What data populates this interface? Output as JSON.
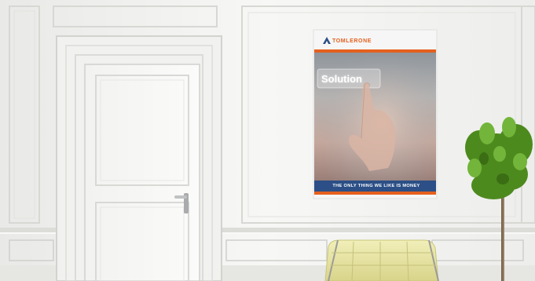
{
  "poster": {
    "brand": "TOMLERONE",
    "headline": "Solution",
    "tagline": "THE ONLY THING WE LIKE IS MONEY"
  },
  "colors": {
    "wall": "#f4f4f2",
    "brand_orange": "#e4601e",
    "banner_blue": "#2b4f86",
    "chair_leather": "#ece9a6",
    "plant_green": "#4d8a1e"
  },
  "icons": [
    "brand-logo-icon"
  ]
}
